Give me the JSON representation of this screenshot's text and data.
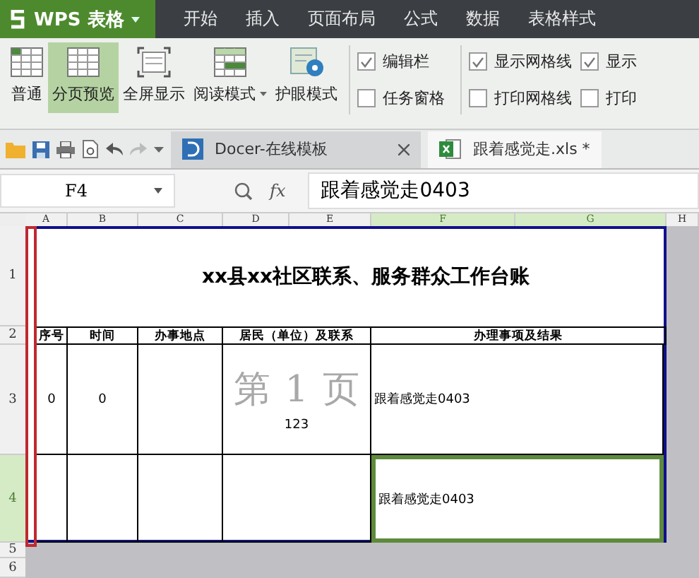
{
  "app": {
    "name": "WPS 表格"
  },
  "menu_tabs": [
    {
      "label": "开始"
    },
    {
      "label": "插入"
    },
    {
      "label": "页面布局"
    },
    {
      "label": "公式"
    },
    {
      "label": "数据"
    },
    {
      "label": "表格样式"
    }
  ],
  "ribbon": {
    "view_buttons": [
      {
        "label": "普通",
        "kind": "normal",
        "selected": false,
        "dropdown": false
      },
      {
        "label": "分页预览",
        "kind": "pagebreak",
        "selected": true,
        "dropdown": false
      },
      {
        "label": "全屏显示",
        "kind": "fullscreen",
        "selected": false,
        "dropdown": false
      },
      {
        "label": "阅读模式",
        "kind": "reading",
        "selected": false,
        "dropdown": true
      },
      {
        "label": "护眼模式",
        "kind": "eye",
        "selected": false,
        "dropdown": false
      }
    ],
    "checkbox_groups": [
      {
        "items": [
          {
            "label": "编辑栏",
            "checked": true
          },
          {
            "label": "任务窗格",
            "checked": false
          }
        ]
      },
      {
        "items": [
          {
            "label": "显示网格线",
            "checked": true
          },
          {
            "label": "打印网格线",
            "checked": false
          }
        ]
      },
      {
        "items": [
          {
            "label": "显示",
            "checked": true
          },
          {
            "label": "打印",
            "checked": false
          }
        ]
      }
    ]
  },
  "doc_tabs": [
    {
      "label": "Docer-在线模板",
      "kind": "docer",
      "selected": true
    },
    {
      "label": "跟着感觉走.xls *",
      "kind": "sheet",
      "selected": false
    }
  ],
  "formula_bar": {
    "cell_ref": "F4",
    "fx_label": "fx",
    "value": "跟着感觉走0403"
  },
  "sheet": {
    "columns": [
      {
        "label": "A",
        "selected": false
      },
      {
        "label": "B",
        "selected": false
      },
      {
        "label": "C",
        "selected": false
      },
      {
        "label": "D",
        "selected": false
      },
      {
        "label": "E",
        "selected": false
      },
      {
        "label": "F",
        "selected": true
      },
      {
        "label": "G",
        "selected": true
      },
      {
        "label": "H",
        "selected": false
      }
    ],
    "row_headers": [
      {
        "label": "1",
        "selected": false
      },
      {
        "label": "2",
        "selected": false
      },
      {
        "label": "3",
        "selected": false
      },
      {
        "label": "4",
        "selected": true
      },
      {
        "label": "5",
        "selected": false
      },
      {
        "label": "6",
        "selected": false
      }
    ],
    "title": "xx县xx社区联系、服务群众工作台账",
    "header": {
      "seq": "序号",
      "time": "时间",
      "place": "办事地点",
      "resident": "居民（单位）及联系",
      "result": "办理事项及结果"
    },
    "rows": [
      {
        "cells": {
          "seq": "0",
          "time": "0",
          "resident": "123",
          "result": "跟着感觉走0403"
        },
        "selected": false
      },
      {
        "cells": {
          "result": "跟着感觉走0403"
        },
        "selected": true
      }
    ],
    "page_watermark": "第 1 页"
  }
}
